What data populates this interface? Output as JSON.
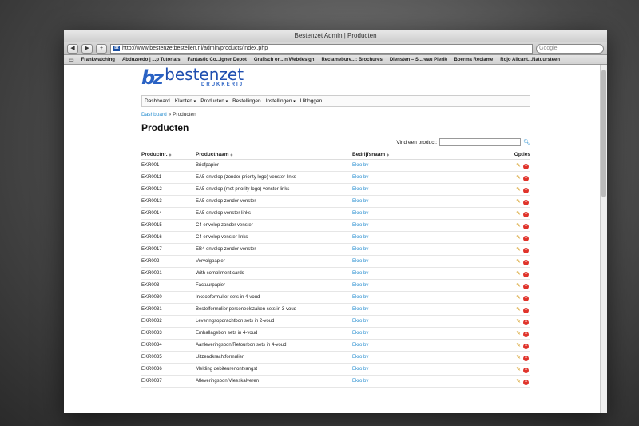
{
  "browser": {
    "window_title": "Bestenzet Admin | Producten",
    "url": "http://www.bestenzetbestellen.nl/admin/products/index.php",
    "search_placeholder": "Google",
    "bookmarks": [
      "Frankwatching",
      "Abduzeedo | ...p Tutorials",
      "Fantastic Co...igner Depot",
      "Grafisch on...n Webdesign",
      "Reclamebure...: Brochures",
      "Diensten – S...reau Pierik",
      "Boerma Reclame",
      "Rojo Alicant...Natuursteen"
    ]
  },
  "logo": {
    "mark": "bz",
    "name": "bestenzet",
    "sub": "DRUKKERIJ"
  },
  "menu": [
    {
      "label": "Dashboard",
      "caret": ""
    },
    {
      "label": "Klanten",
      "caret": "▾"
    },
    {
      "label": "Producten",
      "caret": "▾"
    },
    {
      "label": "Bestellingen",
      "caret": ""
    },
    {
      "label": "Instellingen",
      "caret": "▾"
    },
    {
      "label": "Uitloggen",
      "caret": ""
    }
  ],
  "breadcrumb": {
    "link": "Dashboard",
    "separator": "»",
    "current": "Producten"
  },
  "page_title": "Producten",
  "search": {
    "label": "Vind een product:"
  },
  "table": {
    "headers": {
      "nr": "Productnr.",
      "name": "Productnaam",
      "company": "Bedrijfsnaam",
      "options": "Opties"
    },
    "rows": [
      {
        "nr": "EKR001",
        "name": "Briefpapier",
        "company": "Ekro bv"
      },
      {
        "nr": "EKR0011",
        "name": "EA5 envelop (zonder priority logo) venster links",
        "company": "Ekro bv"
      },
      {
        "nr": "EKR0012",
        "name": "EA5 envelop (met priority logo) venster links",
        "company": "Ekro bv"
      },
      {
        "nr": "EKR0013",
        "name": "EA5 envelop zonder venster",
        "company": "Ekro bv"
      },
      {
        "nr": "EKR0014",
        "name": "EA5 envelop venster links",
        "company": "Ekro bv"
      },
      {
        "nr": "EKR0015",
        "name": "C4 envelop zonder venster",
        "company": "Ekro bv"
      },
      {
        "nr": "EKR0016",
        "name": "C4 envelop venster links",
        "company": "Ekro bv"
      },
      {
        "nr": "EKR0017",
        "name": "EB4 envelop zonder venster",
        "company": "Ekro bv"
      },
      {
        "nr": "EKR002",
        "name": "Vervolgpapier",
        "company": "Ekro bv"
      },
      {
        "nr": "EKR0021",
        "name": "With compliment cards",
        "company": "Ekro bv"
      },
      {
        "nr": "EKR003",
        "name": "Factuurpapier",
        "company": "Ekro bv"
      },
      {
        "nr": "EKR0030",
        "name": "Inkoopformulier sets in 4-voud",
        "company": "Ekro bv"
      },
      {
        "nr": "EKR0031",
        "name": "Bestelformulier personeelszaken sets in 3-voud",
        "company": "Ekro bv"
      },
      {
        "nr": "EKR0032",
        "name": "Leveringsopdrachtbon sets in 2-voud",
        "company": "Ekro bv"
      },
      {
        "nr": "EKR0033",
        "name": "Emballagebon sets in 4-voud",
        "company": "Ekro bv"
      },
      {
        "nr": "EKR0034",
        "name": "Aanleveringsbon/Retourbon sets in 4-voud",
        "company": "Ekro bv"
      },
      {
        "nr": "EKR0035",
        "name": "Uitzendkrachtformulier",
        "company": "Ekro bv"
      },
      {
        "nr": "EKR0036",
        "name": "Melding debiteurenontvangst",
        "company": "Ekro bv"
      },
      {
        "nr": "EKR0037",
        "name": "Afleveringsbon Vleeskalveren",
        "company": "Ekro bv"
      }
    ]
  }
}
